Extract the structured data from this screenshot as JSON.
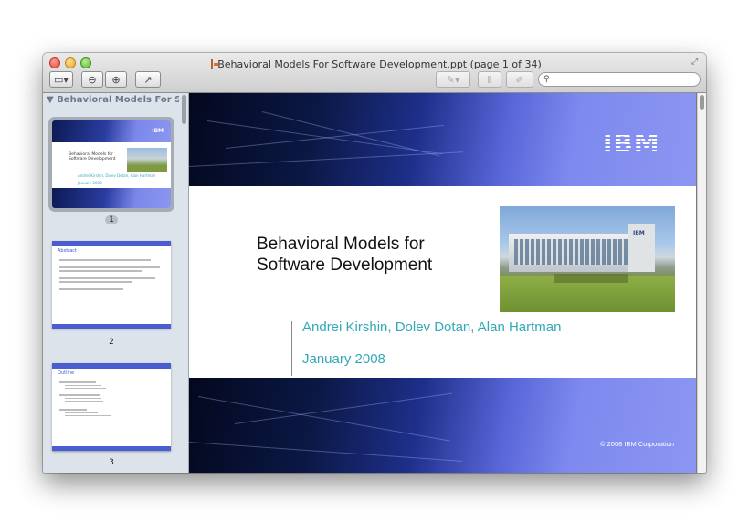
{
  "window": {
    "title": "Behavioral Models For Software Development.ppt (page 1 of 34)"
  },
  "toolbar": {
    "view_icon": "sidebar-icon",
    "zoom_out_icon": "zoom-out-icon",
    "zoom_in_icon": "zoom-in-icon",
    "share_icon": "share-icon",
    "annotate_icon": "pencil-icon",
    "text_icon": "text-icon",
    "edit_icon": "edit-icon",
    "search_placeholder": ""
  },
  "sidebar": {
    "header": "Behavioral Models For Soft...",
    "pages": [
      {
        "number": "1",
        "selected": true
      },
      {
        "number": "2",
        "selected": false
      },
      {
        "number": "3",
        "selected": false
      }
    ],
    "thumb1": {
      "title": "Behavioral Models for Software Development",
      "authors": "Andrei Kirshin, Dolev Dotan, Alan Hartman",
      "date": "January 2008",
      "logo": "IBM"
    },
    "thumb2": {
      "heading": "Abstract"
    },
    "thumb3": {
      "heading": "Outline"
    }
  },
  "slide": {
    "logo": "IBM",
    "title_line1": "Behavioral Models for",
    "title_line2": "Software Development",
    "authors": "Andrei Kirshin, Dolev Dotan, Alan Hartman",
    "date": "January 2008",
    "copyright": "© 2008 IBM Corporation",
    "photo_sign": "IBM"
  },
  "colors": {
    "slide_band_dark": "#0b1845",
    "slide_band_light": "#8c96f2",
    "author_text": "#33a9b7",
    "sidebar_bg": "#dde3ea"
  }
}
